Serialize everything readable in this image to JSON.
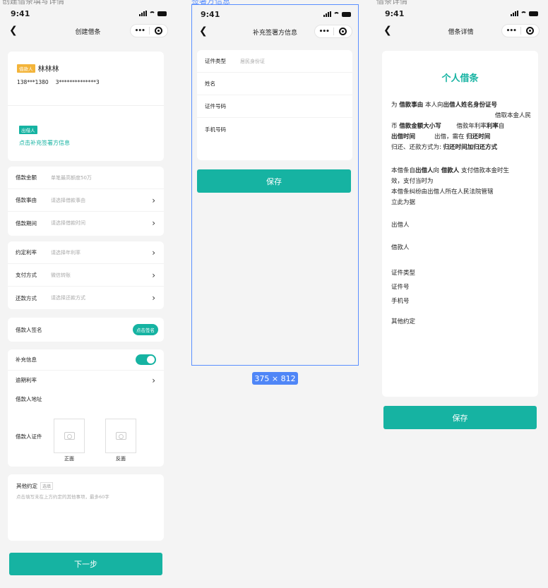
{
  "frames": {
    "f1_title": "创建借条填写详情",
    "f2_title": "签署方信息",
    "f3_title": "借条详情",
    "dimension": "375 × 812"
  },
  "status": {
    "time": "9:41"
  },
  "p1": {
    "title": "创建借条",
    "lender_tag": "借款人",
    "lender_name": "林林林",
    "lender_phone": "138***1380",
    "lender_id": "3**************3",
    "outer_tag": "出借人",
    "outer_link": "点击补充签署方信息",
    "amount_label": "借款金额",
    "amount_ph": "单笔最高额度50万",
    "reason_label": "借款事由",
    "reason_ph": "请选择借款事由",
    "period_label": "借款期间",
    "period_ph": "请选择借款时间",
    "rate_label": "约定利率",
    "rate_ph": "请选择年利率",
    "pay_label": "支付方式",
    "pay_ph": "微信转账",
    "repay_label": "还款方式",
    "repay_ph": "请选择还款方式",
    "sign_label": "借款人签名",
    "sign_btn": "点击签名",
    "extra_label": "补充信息",
    "overdue_label": "逾期利率",
    "address_label": "借款人地址",
    "cert_label": "借款人证件",
    "front": "正面",
    "back": "反面",
    "other_label": "其他约定",
    "optional": "选填",
    "other_ph": "点击填写未在上方约定的其他事项，最多60字",
    "next_btn": "下一步"
  },
  "p2": {
    "title": "补充签署方信息",
    "certtype_label": "证件类型",
    "certtype_ph": "居民身份证",
    "name_label": "姓名",
    "certno_label": "证件号码",
    "phone_label": "手机号码",
    "save_btn": "保存"
  },
  "p3": {
    "title": "借条详情",
    "heading": "个人借条",
    "l1a": "为",
    "l1b": "借款事由",
    "l1c": "本人向",
    "l1d": "出借人姓名身份证号",
    "l2": "借取本金人民",
    "l3a": "币",
    "l3b": "借款金额大小写",
    "l3c": "借款年利率",
    "l3d": "利率",
    "l3e": "自",
    "l4a": "出借时间",
    "l4b": "出借，需在",
    "l4c": "归还时间",
    "l5a": "归还、还款方式为:",
    "l5b": "归还时间加归还方式",
    "p2a": "本借条自",
    "p2b": "出借人",
    "p2c": "向",
    "p2d": "借款人",
    "p2e": "支付借款本金时生",
    "p2f": "效，支付当时为",
    "p2g": "本借条纠纷由出借人所在人民法院管辖",
    "p2h": "立此为据",
    "lender": "出借人",
    "borrower": "借款人",
    "certtype": "证件类型",
    "certno": "证件号",
    "phone": "手机号",
    "other": "其他约定",
    "save_btn": "保存"
  }
}
